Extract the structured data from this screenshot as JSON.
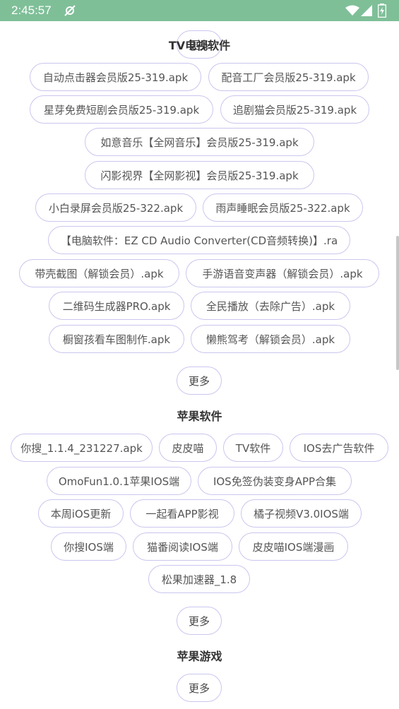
{
  "status_bar": {
    "time": "2:45:57",
    "icons": [
      "notification-icon",
      "wifi-icon",
      "signal-icon",
      "battery-icon"
    ],
    "background": "#7fbf98"
  },
  "sections": [
    {
      "title": "TV电视软件",
      "more_label": "更多",
      "items": [
        "自动点击器会员版25-319.apk",
        "配音工厂会员版25-319.apk",
        "星芽免费短剧会员版25-319.apk",
        "追剧猫会员版25-319.apk",
        "如意音乐【全网音乐】会员版25-319.apk",
        "闪影视界【全网影视】会员版25-319.apk",
        "小白录屏会员版25-322.apk",
        "雨声睡眠会员版25-322.apk",
        "【电脑软件：EZ CD Audio Converter(CD音频转换)】.ra",
        "带壳截图（解锁会员）.apk",
        "手游语音变声器（解锁会员）.apk",
        "二维码生成器PRO.apk",
        "全民播放（去除广告）.apk",
        "橱窗孩看车图制作.apk",
        "懒熊驾考（解锁会员）.apk"
      ]
    },
    {
      "title": "苹果软件",
      "more_label": "更多",
      "items": [
        "你搜_1.1.4_231227.apk",
        "皮皮喵",
        "TV软件",
        "IOS去广告软件",
        "OmoFun1.0.1苹果IOS端",
        "IOS免签伪装变身APP合集",
        "本周iOS更新",
        "一起看APP影视",
        "橘子视频V3.0IOS端",
        "你搜IOS端",
        "猫番阅读IOS端",
        "皮皮喵IOS端漫画",
        "松果加速器_1.8"
      ]
    },
    {
      "title": "苹果游戏",
      "more_label": "更多",
      "items": []
    }
  ],
  "colors": {
    "chip_border": "#c9c6ee",
    "text": "#555555"
  }
}
